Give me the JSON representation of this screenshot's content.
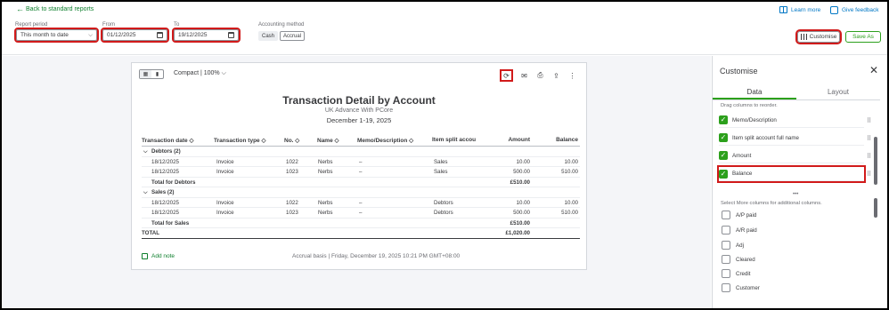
{
  "header": {
    "back_link": "Back to standard reports",
    "learn_more": "Learn more",
    "give_feedback": "Give feedback",
    "report_period_label": "Report period",
    "report_period_value": "This month to date",
    "from_label": "From",
    "from_value": "01/12/2025",
    "to_label": "To",
    "to_value": "19/12/2025",
    "accounting_method_label": "Accounting method",
    "method_cash": "Cash",
    "method_accrual": "Accrual",
    "customise_button": "Customise",
    "save_as_button": "Save As"
  },
  "report": {
    "view_mode": "Compact | 100%",
    "title": "Transaction Detail by Account",
    "company": "UK Advance With PCore",
    "period": "December 1-19, 2025",
    "columns": [
      "Transaction date",
      "Transaction type",
      "No.",
      "Name",
      "Memo/Description",
      "Item split accou",
      "Amount",
      "Balance"
    ],
    "sort_glyph": "◇",
    "groups": [
      {
        "label": "Debtors (2)",
        "rows": [
          {
            "date": "18/12/2025",
            "type": "Invoice",
            "no": "1022",
            "name": "Nerbs",
            "memo": "–",
            "split": "Sales",
            "amount": "10.00",
            "balance": "10.00"
          },
          {
            "date": "18/12/2025",
            "type": "Invoice",
            "no": "1023",
            "name": "Nerbs",
            "memo": "–",
            "split": "Sales",
            "amount": "500.00",
            "balance": "510.00"
          }
        ],
        "total_label": "Total for Debtors",
        "total_amount": "£510.00"
      },
      {
        "label": "Sales (2)",
        "rows": [
          {
            "date": "18/12/2025",
            "type": "Invoice",
            "no": "1022",
            "name": "Nerbs",
            "memo": "–",
            "split": "Debtors",
            "amount": "10.00",
            "balance": "10.00"
          },
          {
            "date": "18/12/2025",
            "type": "Invoice",
            "no": "1023",
            "name": "Nerbs",
            "memo": "–",
            "split": "Debtors",
            "amount": "500.00",
            "balance": "510.00"
          }
        ],
        "total_label": "Total for Sales",
        "total_amount": "£510.00"
      }
    ],
    "grand_total_label": "TOTAL",
    "grand_total_amount": "£1,020.00",
    "add_note": "Add note",
    "footer": "Accrual basis  |  Friday, December 19, 2025 10:21 PM GMT+08:00"
  },
  "panel": {
    "title": "Customise",
    "tab_data": "Data",
    "tab_layout": "Layout",
    "drag_hint": "Drag columns to reorder.",
    "selected_columns": [
      "Memo/Description",
      "Item split account full name",
      "Amount",
      "Balance"
    ],
    "more_hint": "Select More columns for additional columns.",
    "more_columns": [
      "A/P paid",
      "A/R paid",
      "Adj",
      "Cleared",
      "Credit",
      "Customer"
    ]
  },
  "colors": {
    "accent": "#2ca01c",
    "link": "#0077c5",
    "highlight": "#d11a1a"
  }
}
